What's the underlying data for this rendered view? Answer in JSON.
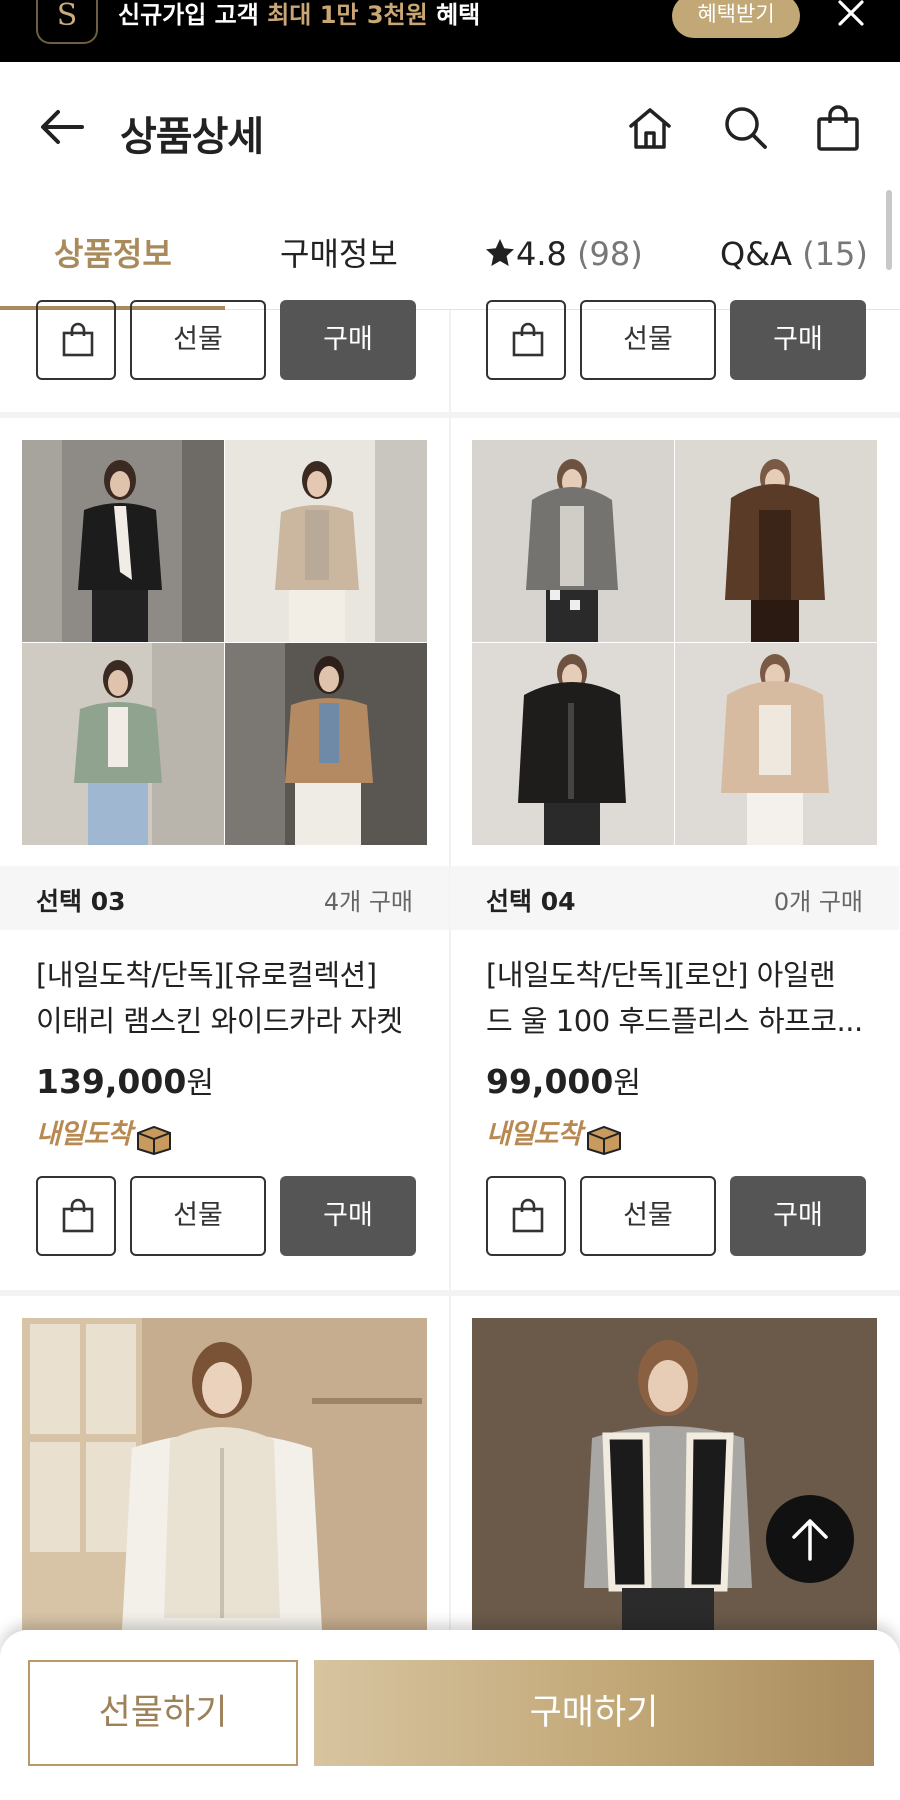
{
  "promo": {
    "logo": "S",
    "text_prefix": "신규가입 고객 ",
    "text_highlight": "최대 1만 3천원",
    "text_suffix": " 혜택",
    "button": "혜택받기",
    "close_icon": "close-icon"
  },
  "header": {
    "title": "상품상세",
    "icons": [
      "back-arrow-icon",
      "home-icon",
      "search-icon",
      "shopping-bag-icon"
    ]
  },
  "tabs": [
    {
      "label": "상품정보",
      "active": true
    },
    {
      "label": "구매정보",
      "active": false
    },
    {
      "label": "4.8",
      "extra": "(98)",
      "icon": "star-icon",
      "active": false
    },
    {
      "label": "Q&A",
      "extra": "(15)",
      "active": false
    }
  ],
  "actions": {
    "gift": "선물",
    "buy": "구매",
    "cart_icon": "shopping-bag-icon"
  },
  "products": [
    {
      "option": "선택 03",
      "purchase_count": "4개 구매",
      "name_line1": "[내일도착/단독][유로컬렉션]",
      "name_line2": "이태리 램스킨 와이드카라 자켓",
      "price": "139,000",
      "currency": "원",
      "badge": "내일도착"
    },
    {
      "option": "선택 04",
      "purchase_count": "0개 구매",
      "name_line1": "[내일도착/단독][로안] 아일랜",
      "name_line2": "드 울 100 후드플리스 하프코...",
      "price": "99,000",
      "currency": "원",
      "badge": "내일도착"
    }
  ],
  "scroll_top_icon": "arrow-up-icon",
  "bottom_bar": {
    "gift": "선물하기",
    "buy": "구매하기"
  },
  "colors": {
    "accent": "#a88a5b",
    "buy_button": "#555555",
    "banner_bg": "#000000"
  }
}
